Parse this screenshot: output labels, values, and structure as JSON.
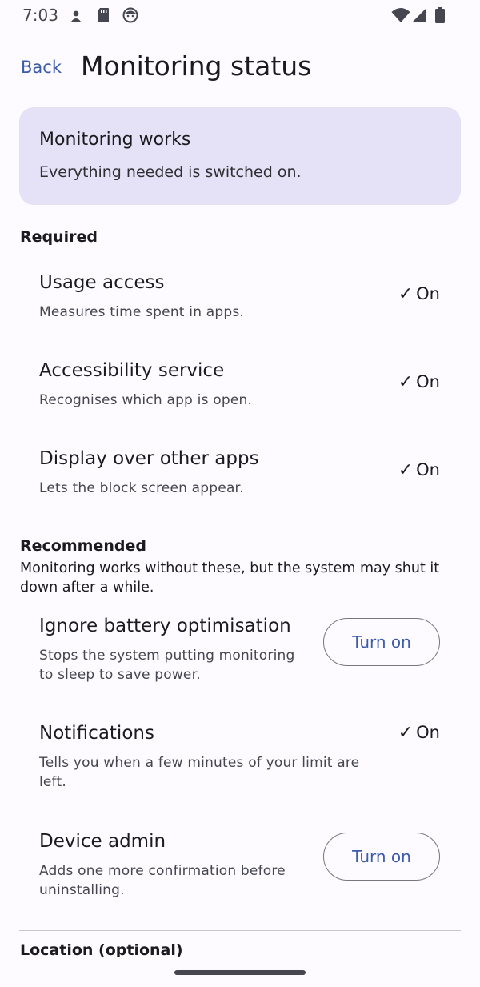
{
  "status_bar": {
    "time": "7:03",
    "left_icons": [
      "person-icon",
      "sd-card-icon",
      "face-icon"
    ],
    "right_icons": [
      "wifi-icon",
      "cell-signal-icon",
      "battery-icon"
    ]
  },
  "app_bar": {
    "back_label": "Back",
    "title": "Monitoring status"
  },
  "summary": {
    "title": "Monitoring works",
    "text": "Everything needed is switched on.",
    "background": "#E5E1F6"
  },
  "required": {
    "heading": "Required",
    "items": [
      {
        "title": "Usage access",
        "desc": "Measures time spent in apps.",
        "status": "On",
        "check": "✓"
      },
      {
        "title": "Accessibility service",
        "desc": "Recognises which app is open.",
        "status": "On",
        "check": "✓"
      },
      {
        "title": "Display over other apps",
        "desc": "Lets the block screen appear.",
        "status": "On",
        "check": "✓"
      }
    ]
  },
  "recommended": {
    "heading": "Recommended",
    "desc": "Monitoring works without these, but the system may shut it down after a while.",
    "items": [
      {
        "title": "Ignore battery optimisation",
        "desc": "Stops the system putting monitoring to sleep to save power.",
        "button": "Turn on"
      },
      {
        "title": "Notifications",
        "desc": "Tells you when a few minutes of your limit are left.",
        "status": "On",
        "check": "✓"
      },
      {
        "title": "Device admin",
        "desc": "Adds one more confirmation before uninstalling.",
        "button": "Turn on"
      }
    ]
  },
  "location": {
    "heading": "Location (optional)"
  },
  "colors": {
    "accent": "#3C5BA9",
    "background": "#FDFBFF",
    "outline": "#75767F"
  }
}
